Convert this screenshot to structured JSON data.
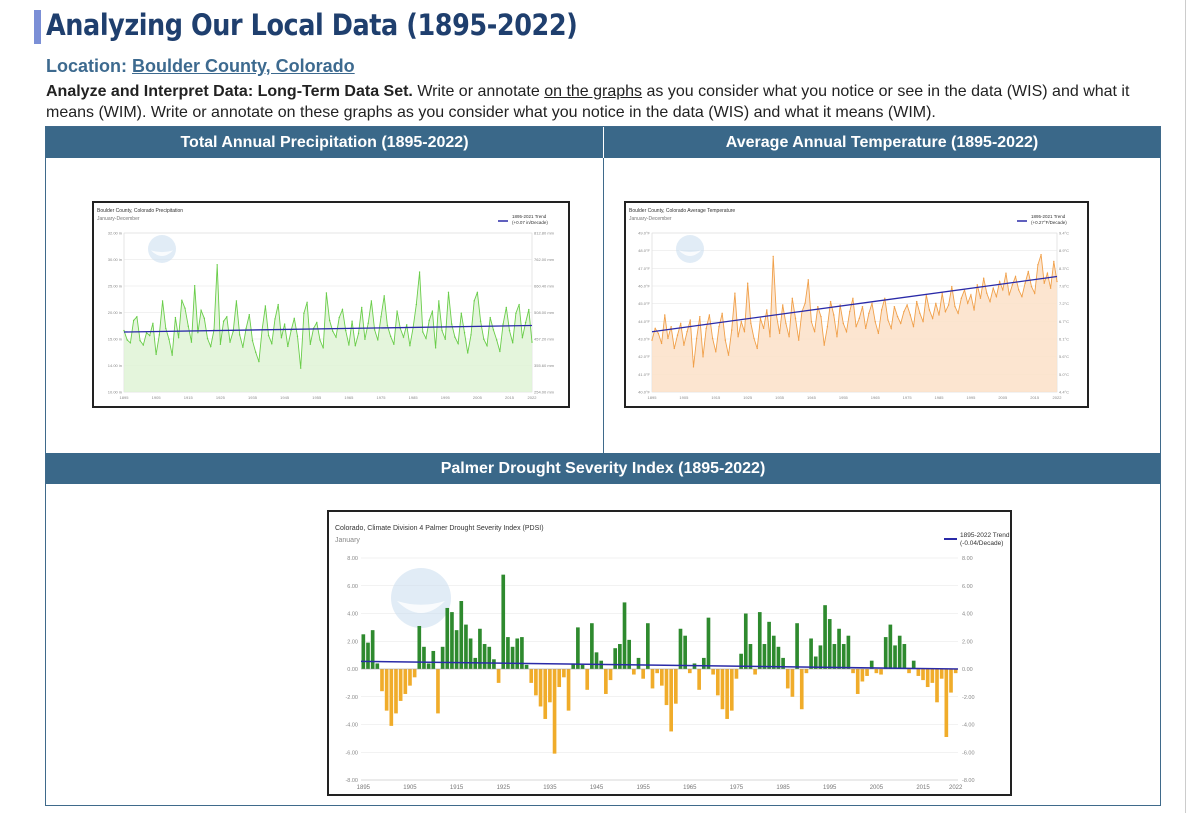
{
  "page": {
    "title": "Analyzing Our Local Data  (1895-2022)",
    "location_label": "Location:",
    "location_value": "Boulder County, Colorado",
    "intro_bold": "Analyze and Interpret Data: Long-Term Data Set.",
    "intro_part1": " Write or annotate ",
    "intro_underlined": "on the graphs",
    "intro_part2": " as you consider what you notice or see in the data (WIS) and what it means (WIM).  Write or annotate on these graphs as you consider what you notice in the data (WIS) and what it means (WIM).",
    "header_precip": "Total Annual Precipitation (1895-2022)",
    "header_temp": "Average Annual Temperature (1895-2022)",
    "header_pdsi": "Palmer Drought Severity Index (1895-2022)"
  },
  "chart_data": [
    {
      "type": "line",
      "title": "Boulder County, Colorado Precipitation",
      "subtitle": "January-December",
      "legend": "1895-2021 Trend",
      "legend_sub": "(+0.07 in/Decade)",
      "line_color": "#6acd4a",
      "fill_color": "#dff3d6",
      "trend_color": "#2a2aa8",
      "ylim": [
        10,
        32
      ],
      "yticks": [
        "32.00 in",
        "30.00 in",
        "25.00 in",
        "20.00 in",
        "15.00 in",
        "14.00 in",
        "10.00 in"
      ],
      "yticks_right": [
        "812.80 mm",
        "762.00 mm",
        "660.40 mm",
        "508.00 mm",
        "457.20 mm",
        "355.60 mm",
        "254.00 mm"
      ],
      "xticks": [
        "1895",
        "1905",
        "1915",
        "1925",
        "1935",
        "1945",
        "1955",
        "1965",
        "1975",
        "1985",
        "1995",
        "2005",
        "2015",
        "2022"
      ],
      "x_start": 1895,
      "values": [
        18.5,
        17.2,
        16.8,
        19.9,
        20.4,
        17.1,
        16.5,
        18.2,
        17.8,
        19.5,
        15.2,
        17.9,
        22.6,
        18.8,
        17.3,
        15.1,
        20.3,
        17.5,
        22.7,
        21.6,
        19.1,
        16.9,
        24.7,
        18.2,
        21.3,
        20.2,
        17.4,
        16.3,
        18.6,
        27.6,
        16.6,
        19.8,
        20.4,
        16.9,
        18.4,
        22.6,
        17.9,
        16.2,
        18.8,
        20.7,
        17.1,
        15.5,
        14.2,
        18.6,
        21.9,
        17.8,
        16.7,
        20.1,
        22.1,
        17.5,
        19.4,
        16.3,
        18.5,
        20.2,
        17.7,
        13.3,
        20.9,
        22.4,
        16.6,
        18.8,
        19.6,
        17.2,
        16.1,
        23.7,
        19.9,
        18.4,
        17.6,
        20.3,
        21.4,
        18.5,
        16.5,
        19.8,
        16.4,
        18.1,
        21.7,
        17.3,
        19.5,
        22.6,
        18.6,
        17.2,
        20.4,
        23.3,
        19.2,
        17.7,
        16.6,
        21.2,
        18.8,
        17.6,
        19.3,
        16.4,
        18.9,
        22.1,
        26.6,
        18.3,
        17.4,
        19.9,
        21.2,
        16.1,
        22.6,
        18.5,
        17.3,
        23.8,
        19.4,
        17.6,
        16.7,
        20.9,
        18.2,
        15.4,
        17.9,
        22.6,
        23.8,
        19.8,
        17.3,
        16.4,
        20.3,
        18.6,
        17.2,
        15.6,
        19.4,
        21.7,
        18.5,
        16.8,
        20.9,
        22.1,
        17.5,
        19.6,
        21.4,
        16.9
      ],
      "trend_start": 18.3,
      "trend_end": 19.2
    },
    {
      "type": "line",
      "title": "Boulder County, Colorado Average Temperature",
      "subtitle": "January-December",
      "legend": "1895-2021 Trend",
      "legend_sub": "(+0.27°F/Decade)",
      "line_color": "#f0a04a",
      "fill_color": "#fbe1c8",
      "trend_color": "#2a2aa8",
      "ylim": [
        40,
        49.5
      ],
      "yticks": [
        "49.0°F",
        "48.0°F",
        "47.0°F",
        "46.0°F",
        "45.0°F",
        "44.0°F",
        "43.0°F",
        "42.0°F",
        "41.0°F",
        "40.0°F"
      ],
      "yticks_right": [
        "9.4°C",
        "8.9°C",
        "8.3°C",
        "7.8°C",
        "7.2°C",
        "6.7°C",
        "6.1°C",
        "5.6°C",
        "5.0°C",
        "4.4°C"
      ],
      "xticks": [
        "1895",
        "1905",
        "1915",
        "1925",
        "1935",
        "1945",
        "1955",
        "1965",
        "1975",
        "1985",
        "1995",
        "2005",
        "2015",
        "2022"
      ],
      "x_start": 1895,
      "values": [
        43.1,
        43.8,
        43.5,
        42.9,
        44.6,
        43.2,
        43.9,
        42.6,
        43.4,
        44.1,
        42.8,
        43.6,
        44.3,
        41.5,
        43.2,
        44.5,
        42.1,
        43.8,
        44.6,
        43.2,
        42.4,
        43.9,
        44.7,
        43.1,
        42.2,
        43.7,
        45.9,
        43.3,
        44.2,
        43.6,
        46.5,
        44.1,
        43.2,
        42.6,
        44.4,
        43.8,
        44.9,
        43.3,
        48.1,
        44.6,
        43.5,
        45.2,
        44.1,
        43.3,
        45.6,
        44.4,
        43.1,
        44.8,
        45.3,
        46.7,
        44.2,
        43.6,
        45.1,
        44.5,
        42.8,
        43.9,
        45.4,
        44.6,
        43.3,
        45.2,
        44.1,
        43.6,
        44.8,
        45.6,
        43.9,
        44.4,
        45.1,
        43.8,
        44.7,
        45.3,
        44.2,
        43.5,
        44.9,
        45.6,
        44.3,
        43.8,
        45.1,
        44.5,
        44.1,
        44.8,
        45.2,
        44.6,
        43.9,
        45.4,
        44.7,
        44.2,
        45.8,
        44.9,
        44.4,
        45.3,
        44.6,
        45.9,
        44.8,
        45.2,
        46.3,
        45.1,
        44.7,
        45.6,
        46.1,
        45.3,
        45.8,
        44.9,
        46.4,
        45.6,
        46.8,
        45.9,
        45.4,
        46.2,
        45.7,
        46.6,
        46.1,
        47.1,
        45.8,
        46.4,
        46.9,
        46.1,
        45.7,
        46.5,
        47.2,
        46.3,
        45.9,
        47.6,
        48.2,
        46.5,
        47.1,
        46.2,
        47.8,
        46.6
      ],
      "trend_start": 43.6,
      "trend_end": 46.9
    },
    {
      "type": "bar",
      "title": "Colorado, Climate Division 4 Palmer Drought Severity Index (PDSI)",
      "subtitle": "January",
      "legend": "1895-2022 Trend",
      "legend_sub": "(-0.04/Decade)",
      "pos_color": "#2e8a2e",
      "neg_color": "#f0ac2a",
      "trend_color": "#2a2aa8",
      "ylim": [
        -8,
        8
      ],
      "yticks": [
        "8.00",
        "6.00",
        "4.00",
        "2.00",
        "0.00",
        "-2.00",
        "-4.00",
        "-6.00",
        "-8.00"
      ],
      "xticks": [
        "1895",
        "1905",
        "1915",
        "1925",
        "1935",
        "1945",
        "1955",
        "1965",
        "1975",
        "1985",
        "1995",
        "2005",
        "2015",
        "2022"
      ],
      "x_start": 1895,
      "values": [
        2.5,
        1.9,
        2.8,
        0.4,
        -1.6,
        -3.0,
        -4.1,
        -3.2,
        -2.3,
        -1.8,
        -1.2,
        -0.6,
        3.1,
        1.6,
        0.4,
        1.3,
        -3.2,
        1.6,
        4.4,
        4.1,
        2.8,
        4.9,
        3.2,
        2.2,
        0.8,
        2.9,
        1.8,
        1.6,
        0.7,
        -1.0,
        6.8,
        2.3,
        1.6,
        2.2,
        2.3,
        0.3,
        -1.0,
        -1.9,
        -2.7,
        -3.6,
        -2.4,
        -6.1,
        -1.3,
        -0.6,
        -3.0,
        0.4,
        3.0,
        0.3,
        -1.5,
        3.3,
        1.2,
        0.6,
        -1.8,
        -0.8,
        1.5,
        1.8,
        4.8,
        2.1,
        -0.4,
        0.8,
        -0.7,
        3.3,
        -1.4,
        -0.3,
        -1.2,
        -2.6,
        -4.5,
        -2.5,
        2.9,
        2.4,
        -0.3,
        0.4,
        -1.5,
        0.8,
        3.7,
        -0.4,
        -1.9,
        -2.9,
        -3.6,
        -3.0,
        -0.7,
        1.1,
        4.0,
        1.8,
        -0.4,
        4.1,
        1.8,
        3.4,
        2.4,
        1.6,
        0.8,
        -1.4,
        -2.0,
        3.3,
        -2.9,
        -0.3,
        2.2,
        0.9,
        1.7,
        4.6,
        3.6,
        1.8,
        2.9,
        1.8,
        2.4,
        -0.3,
        -1.8,
        -0.9,
        -0.5,
        0.6,
        -0.3,
        -0.4,
        2.3,
        3.2,
        1.7,
        2.4,
        1.8,
        -0.3,
        0.6,
        -0.5,
        -0.8,
        -1.3,
        -1.0,
        -2.4,
        -0.7,
        -4.9,
        -1.7,
        -0.3
      ]
    }
  ]
}
